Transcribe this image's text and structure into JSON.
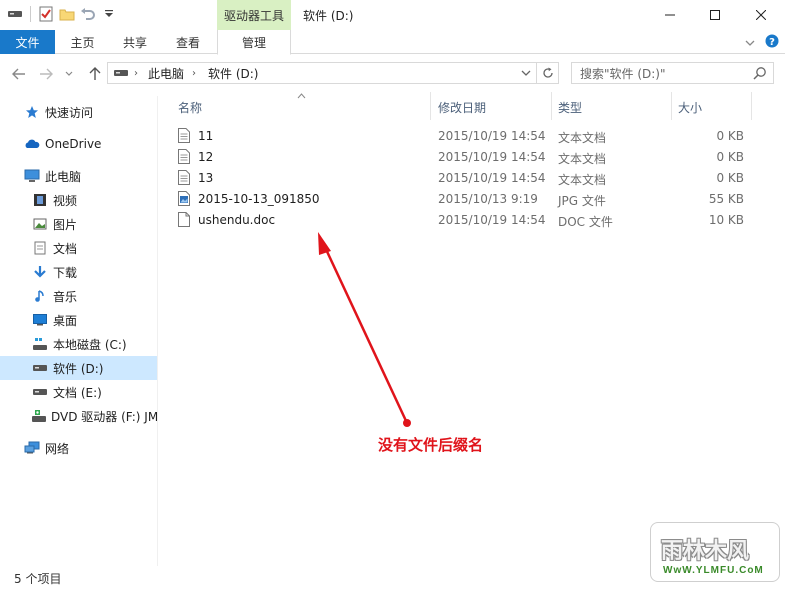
{
  "titlebar": {
    "context_tab": "驱动器工具",
    "title": "软件 (D:)"
  },
  "ribbon": {
    "tabs": [
      {
        "label": "文件"
      },
      {
        "label": "主页"
      },
      {
        "label": "共享"
      },
      {
        "label": "查看"
      },
      {
        "label": "管理"
      }
    ]
  },
  "address": {
    "crumbs": [
      "此电脑",
      "软件 (D:)"
    ]
  },
  "search": {
    "placeholder": "搜索\"软件 (D:)\""
  },
  "navpane": {
    "items": [
      {
        "label": "快速访问",
        "icon": "star-icon"
      },
      {
        "label": "OneDrive",
        "icon": "cloud-icon"
      },
      {
        "label": "此电脑",
        "icon": "computer-icon"
      },
      {
        "label": "视频",
        "icon": "video-icon"
      },
      {
        "label": "图片",
        "icon": "pictures-icon"
      },
      {
        "label": "文档",
        "icon": "documents-icon"
      },
      {
        "label": "下载",
        "icon": "download-icon"
      },
      {
        "label": "音乐",
        "icon": "music-icon"
      },
      {
        "label": "桌面",
        "icon": "desktop-icon"
      },
      {
        "label": "本地磁盘 (C:)",
        "icon": "windows-drive-icon"
      },
      {
        "label": "软件 (D:)",
        "icon": "drive-icon"
      },
      {
        "label": "文档 (E:)",
        "icon": "drive-icon"
      },
      {
        "label": "DVD 驱动器 (F:) JM",
        "icon": "dvd-icon"
      },
      {
        "label": "网络",
        "icon": "network-icon"
      }
    ]
  },
  "columns": {
    "name": "名称",
    "date": "修改日期",
    "type": "类型",
    "size": "大小"
  },
  "files": [
    {
      "name": "11",
      "date": "2015/10/19 14:54",
      "type": "文本文档",
      "size": "0 KB",
      "icon": "text-file-icon"
    },
    {
      "name": "12",
      "date": "2015/10/19 14:54",
      "type": "文本文档",
      "size": "0 KB",
      "icon": "text-file-icon"
    },
    {
      "name": "13",
      "date": "2015/10/19 14:54",
      "type": "文本文档",
      "size": "0 KB",
      "icon": "text-file-icon"
    },
    {
      "name": "2015-10-13_091850",
      "date": "2015/10/13 9:19",
      "type": "JPG 文件",
      "size": "55 KB",
      "icon": "image-file-icon"
    },
    {
      "name": "ushendu.doc",
      "date": "2015/10/19 14:54",
      "type": "DOC 文件",
      "size": "10 KB",
      "icon": "blank-file-icon"
    }
  ],
  "annotation": "没有文件后缀名",
  "status": "5 个项目",
  "watermark": {
    "main": "雨林木风",
    "sub": "WwW.YLMFU.CoM"
  },
  "colors": {
    "accent": "#1979ca",
    "context_tab": "#d9f0c3",
    "selected": "#cde8ff",
    "annotation": "#e0141b"
  }
}
